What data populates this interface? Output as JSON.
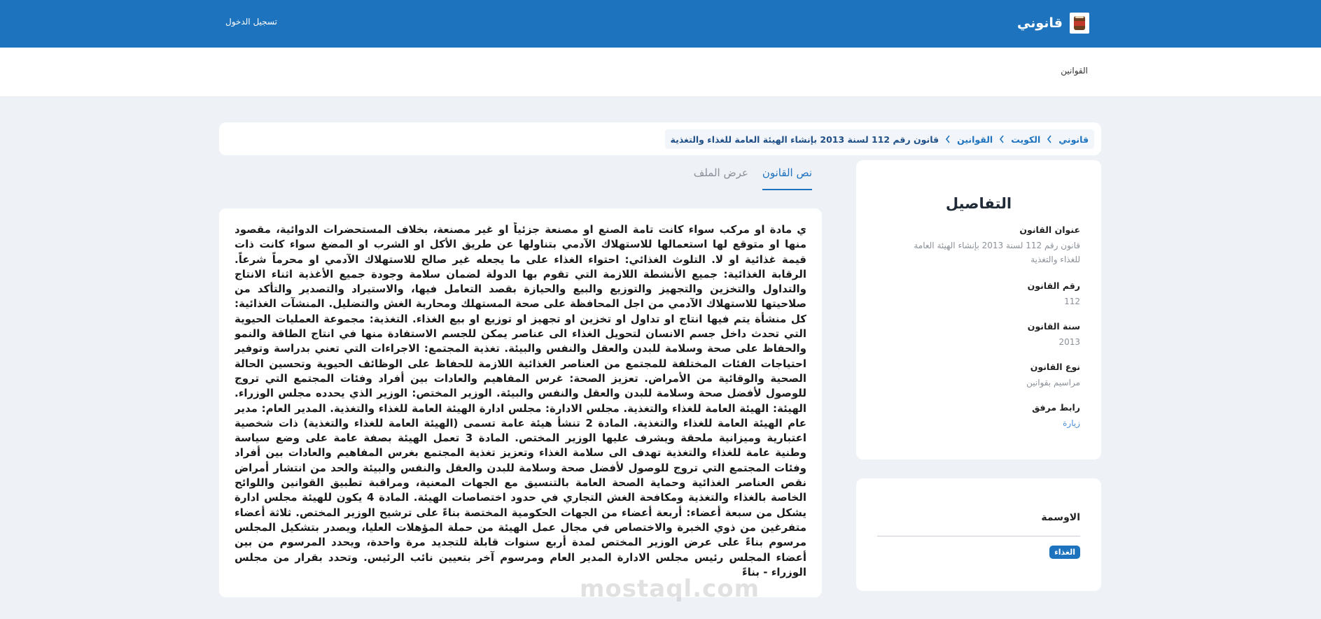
{
  "header": {
    "brand_name": "قانوني",
    "login_label": "تسجيل الدخول"
  },
  "subnav": {
    "laws_label": "القوانين"
  },
  "breadcrumb": [
    "قانوني",
    "الكويت",
    "القوانين",
    "قانون رقم 112 لسنة 2013 بإنشاء الهيئة العامة للغذاء والتغذية"
  ],
  "tabs": {
    "law_text": "نص القانون",
    "view_file": "عرض الملف"
  },
  "law": {
    "body": "ي مادة او مركب سواء كانت تامة الصنع او مصنعة جزئياً او غير مصنعة، بخلاف المستحضرات الدوائية، مقصود منها او متوقع لها استعمالها للاستهلاك الآدمي بتناولها عن طريق الأكل او الشرب او المضغ سواء كانت ذات قيمة غذائية او لا. التلوث الغذائي: احتواء الغذاء على ما يجعله غير صالح للاستهلاك الآدمي او محرماً شرعاً. الرقابة الغذائية: جميع الأنشطة اللازمة التي تقوم بها الدولة لضمان سلامة وجودة جميع الأغذية اثناء الانتاج والتداول والتخزين والتجهيز والتوزيع والبيع والحيازة بقصد التعامل فيها، والاستيراد والتصدير والتأكد من صلاحيتها للاستهلاك الآدمي من اجل المحافظة على صحة المستهلك ومحاربة الغش والتضليل. المنشآت الغذائية: كل منشأة يتم فيها انتاج او تداول او تخزين او تجهيز او توزيع او بيع الغذاء. التغذية: مجموعة العمليات الحيوية التي تحدث داخل جسم الانسان لتحويل الغذاء الى عناصر يمكن للجسم الاستفادة منها في انتاج الطاقة والنمو والحفاظ على صحة وسلامة للبدن والعقل والنفس والبيئة. تغذية المجتمع: الاجراءات التي تعني بدراسة وتوفير احتياجات الفئات المختلفة للمجتمع من العناصر الغذائية اللازمة للحفاظ على الوظائف الحيوية وتحسين الحالة الصحية والوقائية من الأمراض. تعزيز الصحة: غرس المفاهيم والعادات بين أفراد وفئات المجتمع التي تروج للوصول لأفضل صحة وسلامة للبدن والعقل والنفس والبيئة. الوزير المختص: الوزير الذي يحدده مجلس الوزراء. الهيئة: الهيئة العامة للغذاء والتغذية. مجلس الادارة: مجلس ادارة الهيئة العامة للغذاء والتغذية. المدير العام: مدير عام الهيئة العامة للغذاء والتغذية. المادة 2 تنشأ هيئة عامة تسمى (الهيئة العامة للغذاء والتغذية) ذات شخصية اعتبارية وميزانية ملحقة ويشرف عليها الوزير المختص. المادة 3 تعمل الهيئة بصفة عامة على وضع سياسة وطنية عامة للغذاء والتغذية تهدف الى سلامة الغذاء وتعزيز تغذية المجتمع بغرس المفاهيم والعادات بين أفراد وفئات المجتمع التي تروج للوصول لأفضل صحة وسلامة للبدن والعقل والنفس والبيئة والحد من انتشار أمراض نقص العناصر الغذائية وحماية الصحة العامة بالتنسيق مع الجهات المعنية، ومراقبة تطبيق القوانين واللوائح الخاصة بالغذاء والتغذية ومكافحة الغش التجاري في حدود اختصاصات الهيئة. المادة 4 يكون للهيئة مجلس ادارة يشكل من سبعة أعضاء: أربعة أعضاء من الجهات الحكومية المختصة بناءً على ترشيح الوزير المختص. ثلاثة أعضاء متفرغين من ذوي الخبرة والاختصاص في مجال عمل الهيئة من حملة المؤهلات العليا، ويصدر بتشكيل المجلس مرسوم بناءً على عرض الوزير المختص لمدة أربع سنوات قابلة للتجديد مرة واحدة، ويحدد المرسوم من بين أعضاء المجلس رئيس مجلس الادارة المدير العام ومرسوم آخر بتعيين نائب الرئيس. وتحدد بقرار من مجلس الوزراء - بناءً"
  },
  "details": {
    "heading": "التفاصيل",
    "title_label": "عنوان القانون",
    "title_value": "قانون رقم 112 لسنة 2013 بإنشاء الهيئة العامة للغذاء والتغذية",
    "number_label": "رقم القانون",
    "number_value": "112",
    "year_label": "سنة القانون",
    "year_value": "2013",
    "type_label": "نوع القانون",
    "type_value": "مراسيم بقوانين",
    "attachment_label": "رابط مرفق",
    "attachment_value": "زيارة"
  },
  "tags": {
    "heading": "الاوسمة",
    "items": [
      "الغذاء"
    ]
  },
  "watermark": "mostaql.com",
  "colors": {
    "primary": "#1e73be",
    "background": "#eef1f6",
    "muted_text": "#8b9199"
  }
}
